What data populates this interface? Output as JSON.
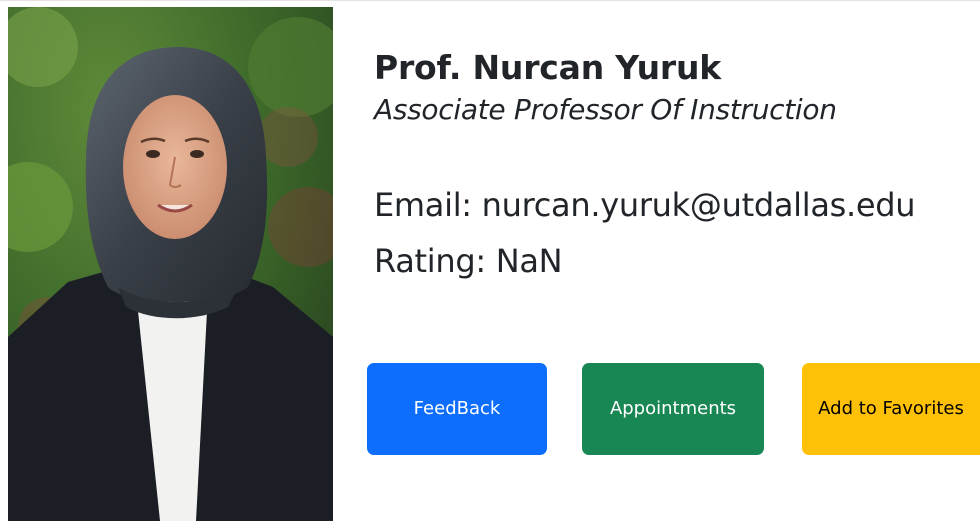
{
  "professor": {
    "name": "Prof. Nurcan Yuruk",
    "title": "Associate Professor Of Instruction",
    "email_line": "Email: nurcan.yuruk@utdallas.edu",
    "rating_line": "Rating: NaN"
  },
  "buttons": {
    "feedback": "FeedBack",
    "appointments": "Appointments",
    "favorites": "Add to Favorites"
  },
  "colors": {
    "feedback": "#0d6efd",
    "appointments": "#198754",
    "favorites": "#ffc107",
    "text": "#212529"
  }
}
